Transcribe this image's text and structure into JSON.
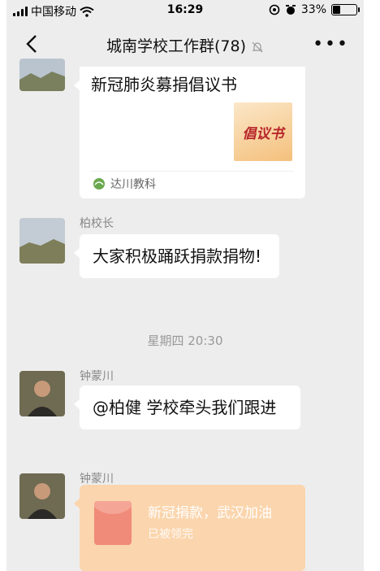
{
  "status_bar": {
    "carrier": "中国移动",
    "time": "16:29",
    "battery": "33%",
    "battery_level": 0.33
  },
  "nav": {
    "title": "城南学校工作群(78)"
  },
  "messages": {
    "card": {
      "title": "新冠肺炎募捐倡议书",
      "thumb_text": "倡议书",
      "source": "达川教科"
    },
    "principal": {
      "sender": "柏校长",
      "text": "大家积极踊跃捐款捐物!"
    },
    "timestamp": "星期四 20:30",
    "mention": {
      "sender": "钟蒙川",
      "text": "@柏健 学校牵头我们跟进"
    },
    "red_packet": {
      "sender": "钟蒙川",
      "title": "新冠捐款，武汉加油",
      "status": "已被领完"
    }
  },
  "colors": {
    "background": "#ededed",
    "bubble": "#ffffff",
    "red_packet": "#fbd5ad"
  }
}
